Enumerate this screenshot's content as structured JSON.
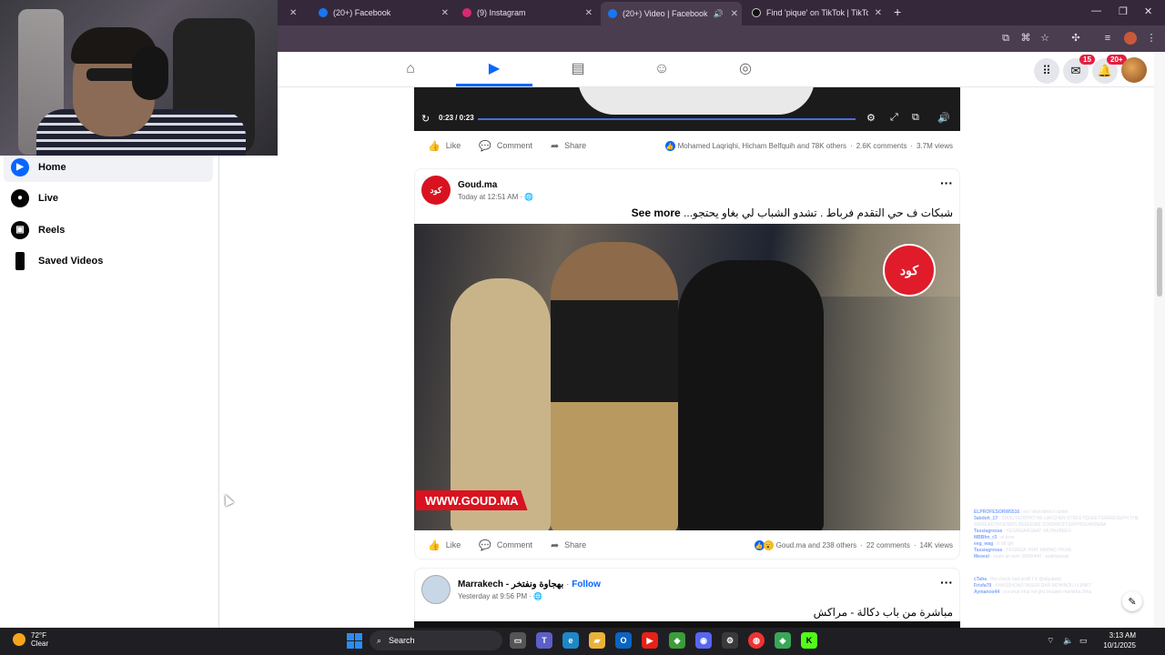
{
  "browser": {
    "tabs": [
      {
        "label": "(20+) Facebook",
        "favicon_color": "#1877f2",
        "active": false
      },
      {
        "label": "(9) Instagram",
        "favicon_color": "#d62976",
        "active": false
      },
      {
        "label": "(20+) Video | Facebook",
        "favicon_color": "#1877f2",
        "active": true
      },
      {
        "label": "Find 'pique' on TikTok | TikTok",
        "favicon_color": "#111111",
        "active": false
      }
    ],
    "new_tab_label": "+"
  },
  "fb_nav": {
    "icons": [
      "home-icon",
      "video-icon",
      "marketplace-icon",
      "groups-icon",
      "gaming-icon"
    ],
    "active": "video-icon",
    "messenger_badge": "15",
    "notifications_badge": "20+"
  },
  "sidebar": {
    "items": [
      {
        "label": "Home",
        "icon": "home-video-icon",
        "active": true
      },
      {
        "label": "Live",
        "icon": "live-icon",
        "active": false
      },
      {
        "label": "Reels",
        "icon": "reels-icon",
        "active": false
      },
      {
        "label": "Saved Videos",
        "icon": "bookmark-icon",
        "active": false
      }
    ]
  },
  "top_video": {
    "time": "0:23 / 0:23",
    "progress": 1.0,
    "actions": {
      "like": "Like",
      "comment": "Comment",
      "share": "Share"
    },
    "reactions_text": "Mohamed Laqriqhi, Hicham Belfquih and 78K others",
    "comments": "2.6K comments",
    "views": "3.7M views"
  },
  "post1": {
    "author": "Goud.ma",
    "avatar_text": "كود",
    "time": "Today at 12:51 AM · ",
    "caption": "شبكات ف حي التقدم فرباط . تشدو الشباب لي بغاو يحتجو...",
    "see_more": "See more",
    "logo_text": "كود",
    "watermark": "WWW.GOUD.MA",
    "actions": {
      "like": "Like",
      "comment": "Comment",
      "share": "Share"
    },
    "reactions_text": "Goud.ma and 238 others",
    "comments": "22 comments",
    "views": "14K views"
  },
  "post2": {
    "author": "Marrakech - بهجاوة ونفتخر",
    "follow": "Follow",
    "separator": " · ",
    "time": "Yesterday at 9:56 PM · ",
    "caption": "مباشرة من باب دكالة - مراكش"
  },
  "chat": [
    {
      "user": "ELPROFESORW5516",
      "msg": " : ed I described it toster"
    },
    {
      "user": "3abdoh_17",
      "msg": " : SHOUTEFBPHT HE LAKCHEN STREETQUEETSRARESEPH THE"
    },
    {
      "user": "",
      "msg": "WEREARTHOENRIS BEEFENIE STADRICETSKIPHGUARIIEAA"
    },
    {
      "user": "Tassiagresse",
      "msg": " : YEGREIARGAAT VA TAVIBEEV"
    },
    {
      "user": "MBBfm_r3",
      "msg": " : at tone"
    },
    {
      "user": "eeg_wag",
      "msg": " : ill 98 ghi"
    },
    {
      "user": "Tassiagresse",
      "msg": " : YEGREIA THAT MIMIAD TIKUR"
    },
    {
      "user": "Meoesl",
      "msg": " : veale an bein 3W9X440 : walktopwak"
    },
    {
      "user": "cTaha",
      "msg": " : Bro check had profil f X @alguitedz"
    },
    {
      "user": "Frivfa79",
      "msg": " : KHASSHOMJ 9ASSR DAR MOHINOU LI 8NKT"
    },
    {
      "user": "Aymanoo44",
      "msg": " : sot wsal nhar lwl gha bnaden mamkha 3lina"
    }
  ],
  "taskbar": {
    "weather_temp": "72°F",
    "weather_desc": "Clear",
    "search_label": "Search",
    "time": "3:13 AM",
    "date": "10/1/2025"
  }
}
